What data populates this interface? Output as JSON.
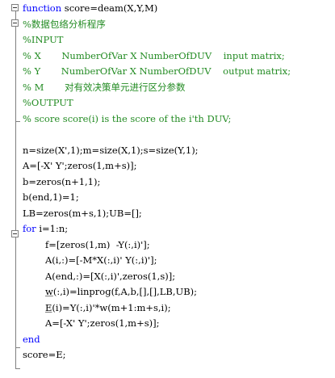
{
  "editor": {
    "lines": [
      {
        "indent": 0,
        "parts": [
          {
            "t": "function",
            "c": "kw"
          },
          {
            "t": " score=deam(X,Y,M)",
            "c": "code"
          }
        ]
      },
      {
        "indent": 0,
        "parts": [
          {
            "t": "%数据包络分析程序",
            "c": "cm"
          }
        ]
      },
      {
        "indent": 0,
        "parts": [
          {
            "t": "%INPUT",
            "c": "cm"
          }
        ]
      },
      {
        "indent": 0,
        "parts": [
          {
            "t": "% X       NumberOfVar X NumberOfDUV    input matrix;",
            "c": "cm"
          }
        ]
      },
      {
        "indent": 0,
        "parts": [
          {
            "t": "% Y       NumberOfVar X NumberOfDUV    output matrix;",
            "c": "cm"
          }
        ]
      },
      {
        "indent": 0,
        "parts": [
          {
            "t": "% M       对有效决策单元进行区分参数",
            "c": "cm"
          }
        ]
      },
      {
        "indent": 0,
        "parts": [
          {
            "t": "%OUTPUT",
            "c": "cm"
          }
        ]
      },
      {
        "indent": 0,
        "parts": [
          {
            "t": "% score score(i) is the score of the i'th DUV;",
            "c": "cm"
          }
        ]
      },
      {
        "indent": 0,
        "parts": []
      },
      {
        "indent": 0,
        "parts": [
          {
            "t": "n=size(X',1);m=size(X,1);s=size(Y,1);",
            "c": "code"
          }
        ]
      },
      {
        "indent": 0,
        "parts": [
          {
            "t": "A=[-X' Y';zeros(1,m+s)];",
            "c": "code"
          }
        ]
      },
      {
        "indent": 0,
        "parts": [
          {
            "t": "b=zeros(n+1,1);",
            "c": "code"
          }
        ]
      },
      {
        "indent": 0,
        "parts": [
          {
            "t": "b(end,1)=1;",
            "c": "code"
          }
        ]
      },
      {
        "indent": 0,
        "parts": [
          {
            "t": "LB=zeros(m+s,1);UB=[];",
            "c": "code"
          }
        ]
      },
      {
        "indent": 0,
        "parts": [
          {
            "t": "for",
            "c": "kw"
          },
          {
            "t": " i=1:n;",
            "c": "code"
          }
        ]
      },
      {
        "indent": 1,
        "parts": [
          {
            "t": "f=[zeros(1,m)  -Y(:,i)'];",
            "c": "code"
          }
        ]
      },
      {
        "indent": 1,
        "parts": [
          {
            "t": "A(i,:)=[-M*X(:,i)' Y(:,i)'];",
            "c": "code"
          }
        ]
      },
      {
        "indent": 1,
        "parts": [
          {
            "t": "A(end,:)=[X(:,i)',zeros(1,s)];",
            "c": "code"
          }
        ]
      },
      {
        "indent": 1,
        "parts": [
          {
            "t": "w",
            "c": "code ul"
          },
          {
            "t": "(:,i)=linprog(f,A,b,[],[],LB,UB);",
            "c": "code"
          }
        ]
      },
      {
        "indent": 1,
        "parts": [
          {
            "t": "E",
            "c": "code ul"
          },
          {
            "t": "(i)=Y(:,i)'*w(m+1:m+s,i);",
            "c": "code"
          }
        ]
      },
      {
        "indent": 1,
        "parts": [
          {
            "t": "A=[-X' Y';zeros(1,m+s)];",
            "c": "code"
          }
        ]
      },
      {
        "indent": 0,
        "parts": [
          {
            "t": "end",
            "c": "kw"
          }
        ]
      },
      {
        "indent": 0,
        "parts": [
          {
            "t": "score=E;",
            "c": "code"
          }
        ]
      }
    ]
  }
}
